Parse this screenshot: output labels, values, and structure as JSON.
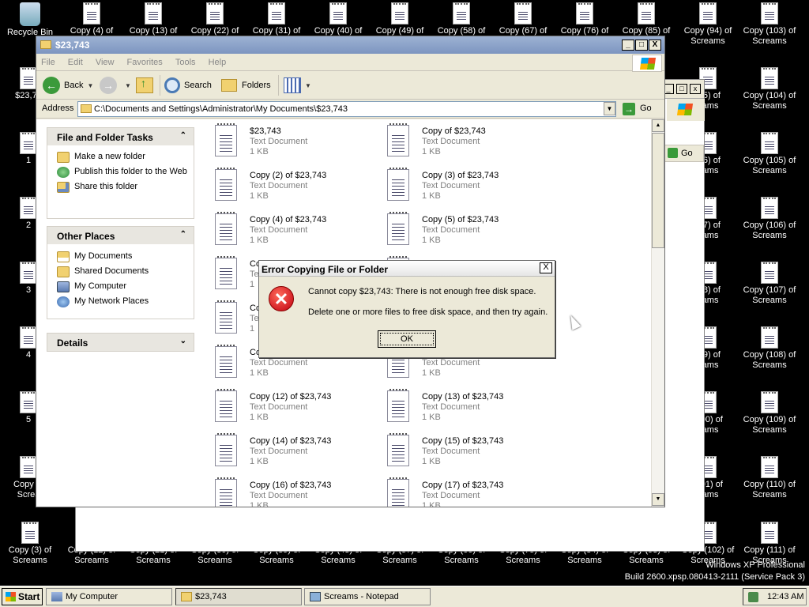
{
  "desktop": {
    "top_labels": [
      {
        "l1": "Recycle Bin",
        "l2": ""
      },
      {
        "l1": "Copy (4) of",
        "l2": ""
      },
      {
        "l1": "Copy (13) of",
        "l2": ""
      },
      {
        "l1": "Copy (22) of",
        "l2": ""
      },
      {
        "l1": "Copy (31) of",
        "l2": ""
      },
      {
        "l1": "Copy (40) of",
        "l2": ""
      },
      {
        "l1": "Copy (49) of",
        "l2": ""
      },
      {
        "l1": "Copy (58) of",
        "l2": ""
      },
      {
        "l1": "Copy (67) of",
        "l2": ""
      },
      {
        "l1": "Copy (76) of",
        "l2": ""
      },
      {
        "l1": "Copy (85) of",
        "l2": ""
      },
      {
        "l1": "Copy (94) of",
        "l2": "Screams"
      },
      {
        "l1": "Copy (103) of",
        "l2": "Screams"
      }
    ],
    "right_col_a": [
      {
        "l1": "(95) of",
        "l2": "eams"
      },
      {
        "l1": "(96) of",
        "l2": "eams"
      },
      {
        "l1": "(97) of",
        "l2": "eams"
      },
      {
        "l1": "(98) of",
        "l2": "eams"
      },
      {
        "l1": "(99) of",
        "l2": "eams"
      },
      {
        "l1": "(100) of",
        "l2": "eams"
      },
      {
        "l1": "(101) of",
        "l2": "eams"
      }
    ],
    "right_col_b": [
      {
        "l1": "Copy (104) of",
        "l2": "Screams"
      },
      {
        "l1": "Copy (105) of",
        "l2": "Screams"
      },
      {
        "l1": "Copy (106) of",
        "l2": "Screams"
      },
      {
        "l1": "Copy (107) of",
        "l2": "Screams"
      },
      {
        "l1": "Copy (108) of",
        "l2": "Screams"
      },
      {
        "l1": "Copy (109) of",
        "l2": "Screams"
      },
      {
        "l1": "Copy (110) of",
        "l2": "Screams"
      }
    ],
    "left_col": [
      "$23,74",
      "1",
      "2",
      "3",
      "4",
      "5"
    ],
    "left_bottom": {
      "l1": "Copy of",
      "l2": "Screa"
    },
    "bottom_labels": [
      {
        "l1": "Copy (3) of",
        "l2": "Screams"
      },
      {
        "l1": "Copy (12) of",
        "l2": "Screams"
      },
      {
        "l1": "Copy (21) of",
        "l2": "Screams"
      },
      {
        "l1": "Copy (30) of",
        "l2": "Screams"
      },
      {
        "l1": "Copy (39) of",
        "l2": "Screams"
      },
      {
        "l1": "Copy (48) of",
        "l2": "Screams"
      },
      {
        "l1": "Copy (57) of",
        "l2": "Screams"
      },
      {
        "l1": "Copy (66) of",
        "l2": "Screams"
      },
      {
        "l1": "Copy (75) of",
        "l2": "Screams"
      },
      {
        "l1": "Copy (84) of",
        "l2": "Screams"
      },
      {
        "l1": "Copy (93) of",
        "l2": "Screams"
      },
      {
        "l1": "Copy (102) of",
        "l2": "Screams"
      },
      {
        "l1": "Copy (111) of",
        "l2": "Screams"
      }
    ],
    "watermark_line1": "Windows XP Professional",
    "watermark_line2": "Build 2600.xpsp.080413-2111 (Service Pack 3)"
  },
  "ghost_window": {
    "go_label": "Go"
  },
  "window": {
    "title": "$23,743",
    "min_label": "_",
    "max_label": "□",
    "close_label": "X",
    "menu": [
      "File",
      "Edit",
      "View",
      "Favorites",
      "Tools",
      "Help"
    ],
    "toolbar": {
      "back": "Back",
      "search": "Search",
      "folders": "Folders"
    },
    "address_label": "Address",
    "address_value": "C:\\Documents and Settings\\Administrator\\My Documents\\$23,743",
    "go_label": "Go"
  },
  "left_pane": {
    "tasks": {
      "title": "File and Folder Tasks",
      "items": [
        "Make a new folder",
        "Publish this folder to the Web",
        "Share this folder"
      ]
    },
    "other_places": {
      "title": "Other Places",
      "items": [
        "My Documents",
        "Shared Documents",
        "My Computer",
        "My Network Places"
      ]
    },
    "details": {
      "title": "Details"
    }
  },
  "files": [
    {
      "name": "$23,743",
      "type": "Text Document",
      "size": "1 KB"
    },
    {
      "name": "Copy of $23,743",
      "type": "Text Document",
      "size": "1 KB"
    },
    {
      "name": "Copy (2) of $23,743",
      "type": "Text Document",
      "size": "1 KB"
    },
    {
      "name": "Copy (3) of $23,743",
      "type": "Text Document",
      "size": "1 KB"
    },
    {
      "name": "Copy (4) of $23,743",
      "type": "Text Document",
      "size": "1 KB"
    },
    {
      "name": "Copy (5) of $23,743",
      "type": "Text Document",
      "size": "1 KB"
    },
    {
      "name": "Co",
      "type": "Te",
      "size": "1"
    },
    {
      "name": "",
      "type": "",
      "size": ""
    },
    {
      "name": "Co",
      "type": "Te",
      "size": "1"
    },
    {
      "name": "",
      "type": "",
      "size": ""
    },
    {
      "name": "Co",
      "type": "Text Document",
      "size": "1 KB"
    },
    {
      "name": "",
      "type": "Text Document",
      "size": "1 KB"
    },
    {
      "name": "Copy (12) of $23,743",
      "type": "Text Document",
      "size": "1 KB"
    },
    {
      "name": "Copy (13) of $23,743",
      "type": "Text Document",
      "size": "1 KB"
    },
    {
      "name": "Copy (14) of $23,743",
      "type": "Text Document",
      "size": "1 KB"
    },
    {
      "name": "Copy (15) of $23,743",
      "type": "Text Document",
      "size": "1 KB"
    },
    {
      "name": "Copy (16) of $23,743",
      "type": "Text Document",
      "size": "1 KB"
    },
    {
      "name": "Copy (17) of $23,743",
      "type": "Text Document",
      "size": "1 KB"
    }
  ],
  "dialog": {
    "title": "Error Copying File or Folder",
    "close_label": "X",
    "message1": "Cannot copy $23,743: There is not enough free disk space.",
    "message2": "Delete one or more files to free disk space, and then try again.",
    "ok_label": "OK",
    "icon_glyph": "✕"
  },
  "taskbar": {
    "start_label": "Start",
    "tasks": [
      "My Computer",
      "$23,743",
      "Screams - Notepad"
    ],
    "clock": "12:43 AM"
  }
}
